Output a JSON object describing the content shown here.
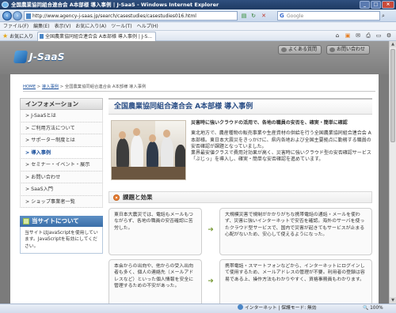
{
  "window": {
    "title": "全国農業協同組合連合会 A本部様 導入事例 | J-SaaS - Windows Internet Explorer",
    "buttons": [
      "_",
      "□",
      "×"
    ]
  },
  "addressbar": {
    "url": "http://www.agency-j-saas.jp/search/casestudies/casestudies016.html",
    "search_placeholder": "Google",
    "search_logo": "G"
  },
  "menubar": [
    "ファイル(F)",
    "編集(E)",
    "表示(V)",
    "お気に入り(A)",
    "ツール(T)",
    "ヘルプ(H)"
  ],
  "favbar": {
    "favorites_label": "お気に入り",
    "tab_title": "全国農業協同組合連合会 A本部様 導入事例 | J-S..."
  },
  "site": {
    "logo_text": "J-SaaS",
    "faq_button": "よくある質問",
    "contact_button": "お問い合わせ"
  },
  "breadcrumb": {
    "home": "HOME",
    "sep1": " > ",
    "cases": "導入事例",
    "sep2": " > ",
    "current": "全国農業協同組合連合会 A本部様 導入事例"
  },
  "leftnav": {
    "heading": "インフォメーション",
    "items": [
      {
        "label": "J-SaaSとは",
        "active": false
      },
      {
        "label": "ご利用方法について",
        "active": false
      },
      {
        "label": "サポーター制度とは",
        "active": false
      },
      {
        "label": "導入事例",
        "active": true
      },
      {
        "label": "セミナー・イベント・展示",
        "active": false
      },
      {
        "label": "お問い合わせ",
        "active": false
      },
      {
        "label": "SaaS入門",
        "active": false
      },
      {
        "label": "ショップ事業者一覧",
        "active": false
      }
    ],
    "info_heading": "当サイトについて",
    "info_body": "当サイトはJavaScriptを使用しています。JavaScriptを有効にしてください。"
  },
  "main": {
    "title": "全国農業協同組合連合会 A本部様 導入事例",
    "lead": "災害時に強いクラウドの活用で、各地の職員の安否を、確実・簡単に確認",
    "para1": "東北地方で、農産種物の販売事業や生産資材の供給を行う全国農業協同組合連合会 A本部様。東日本大震災をきっかけに、県内各地および全国主要拠点に勤務する職員の安否確認が課題となっていました。",
    "para2": "業界最安値クラスで費用対効果が高く、災害時に強いクラウド型の安否確認サービス「ぶじっ」を導入し、確実・簡単な安否確認を進めています。",
    "section_title": "課題と効果",
    "rows": [
      {
        "problem": "東日本大震災では、電話もメールもつながらず、各地の職員の安否確認に苦労した。",
        "effect": "大規模災害で規制がかかりがちな携帯電話の通話・メールを使わず、災害に強いインターネットで安否を確認。海外のサーバを使ったクラウド型サービスで、国内で災害が起きてもサービスが止まる心配がないため、安心して使えるようになった。"
      },
      {
        "problem": "本会からの出向や、他からの受入出向者も多く、個人の連絡先（メールアドレスなど）といった個人情報を安全に管理するための不安があった。",
        "effect": "携帯電話・スマートフォンなどから、インターネットにログインして使用するため、メールアドレスの管理が不要。利用者の登録は容易である上、操作方法もわかりやすく、資格事務員もわかります。"
      }
    ]
  },
  "statusbar": {
    "zone": "インターネット | 保護モード: 無効",
    "zoom": "100%"
  }
}
